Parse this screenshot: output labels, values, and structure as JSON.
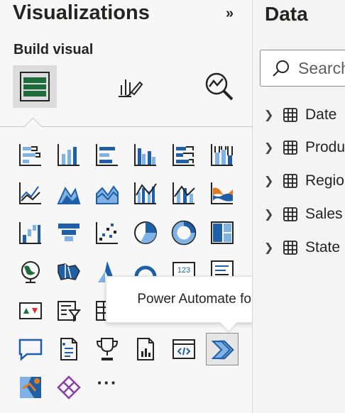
{
  "visualizations": {
    "title": "Visualizations",
    "collapse_glyph": "»",
    "build_label": "Build visual",
    "modes": [
      {
        "name": "build-visual-mode",
        "icon": "table-fields-icon",
        "active": true
      },
      {
        "name": "format-visual-mode",
        "icon": "paintbrush-chart-icon",
        "active": false
      },
      {
        "name": "analytics-mode",
        "icon": "magnifier-chart-icon",
        "active": false
      }
    ],
    "more_visuals": "···",
    "tooltip": "Power Automate for Power BI"
  },
  "data_pane": {
    "title": "Data",
    "search_placeholder": "Search",
    "tables": [
      "Date",
      "Product",
      "Region",
      "Sales",
      "State"
    ]
  },
  "colors": {
    "accent": "#1f5fa8",
    "blue_light": "#7fb2e5",
    "green": "#1e6b3b",
    "orange": "#e07b1f",
    "purple": "#8a3ea8"
  }
}
